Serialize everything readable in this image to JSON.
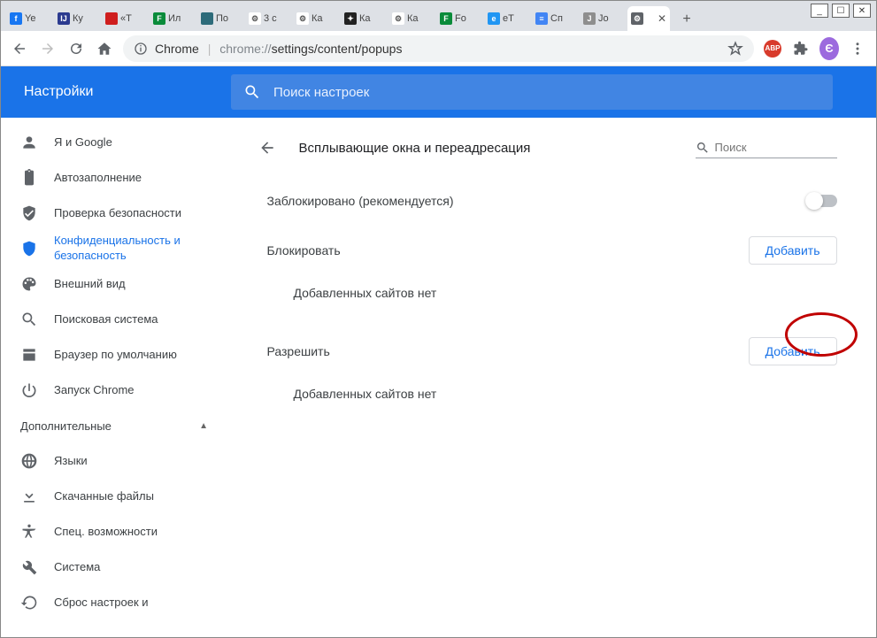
{
  "window_controls": {
    "min": "_",
    "max": "☐",
    "close": "✕"
  },
  "tabs": [
    {
      "title": "Ye",
      "favicon_bg": "#1877f2",
      "favicon_txt": "f"
    },
    {
      "title": "Ку",
      "favicon_bg": "#2b3a8f",
      "favicon_txt": "IJ"
    },
    {
      "title": "«Т",
      "favicon_bg": "#cf1e1e",
      "favicon_txt": ""
    },
    {
      "title": "Ил",
      "favicon_bg": "#0a8b3a",
      "favicon_txt": "F"
    },
    {
      "title": "По",
      "favicon_bg": "#2d6b7a",
      "favicon_txt": ""
    },
    {
      "title": "3 с",
      "favicon_bg": "#ffffff",
      "favicon_txt": "⚙"
    },
    {
      "title": "Ка",
      "favicon_bg": "#ffffff",
      "favicon_txt": "⚙"
    },
    {
      "title": "Ка",
      "favicon_bg": "#222",
      "favicon_txt": "✦"
    },
    {
      "title": "Ка",
      "favicon_bg": "#ffffff",
      "favicon_txt": "⚙"
    },
    {
      "title": "Fo",
      "favicon_bg": "#0a8b3a",
      "favicon_txt": "F"
    },
    {
      "title": "eT",
      "favicon_bg": "#2196f3",
      "favicon_txt": "e"
    },
    {
      "title": "Сп",
      "favicon_bg": "#4285f4",
      "favicon_txt": "≡"
    },
    {
      "title": "Jo",
      "favicon_bg": "#8e8e8e",
      "favicon_txt": "J"
    },
    {
      "title": "",
      "favicon_bg": "#5f6368",
      "favicon_txt": "⚙",
      "active": true
    }
  ],
  "new_tab": "+",
  "address": {
    "scheme_label": "Chrome",
    "url_prefix": "chrome://",
    "url_rest": "settings/content/popups"
  },
  "extensions": {
    "abp": "ABP",
    "avatar_letter": "Є"
  },
  "settings_header": {
    "title": "Настройки",
    "search_placeholder": "Поиск настроек"
  },
  "sidebar": {
    "items": [
      {
        "label": "Я и Google",
        "icon": "person"
      },
      {
        "label": "Автозаполнение",
        "icon": "clipboard"
      },
      {
        "label": "Проверка безопасности",
        "icon": "shield-check"
      },
      {
        "label": "Конфиденциальность и безопасность",
        "icon": "shield",
        "selected": true
      },
      {
        "label": "Внешний вид",
        "icon": "palette"
      },
      {
        "label": "Поисковая система",
        "icon": "search"
      },
      {
        "label": "Браузер по умолчанию",
        "icon": "window"
      },
      {
        "label": "Запуск Chrome",
        "icon": "power"
      }
    ],
    "advanced_label": "Дополнительные",
    "advanced_items": [
      {
        "label": "Языки",
        "icon": "globe"
      },
      {
        "label": "Скачанные файлы",
        "icon": "download"
      },
      {
        "label": "Спец. возможности",
        "icon": "accessibility"
      },
      {
        "label": "Система",
        "icon": "wrench"
      },
      {
        "label": "Сброс настроек и",
        "icon": "restore"
      }
    ]
  },
  "main": {
    "page_title": "Всплывающие окна и переадресация",
    "search_placeholder": "Поиск",
    "blocked_row_label": "Заблокировано (рекомендуется)",
    "block_section": {
      "header": "Блокировать",
      "add_button": "Добавить",
      "empty": "Добавленных сайтов нет"
    },
    "allow_section": {
      "header": "Разрешить",
      "add_button": "Добавить",
      "empty": "Добавленных сайтов нет"
    }
  }
}
